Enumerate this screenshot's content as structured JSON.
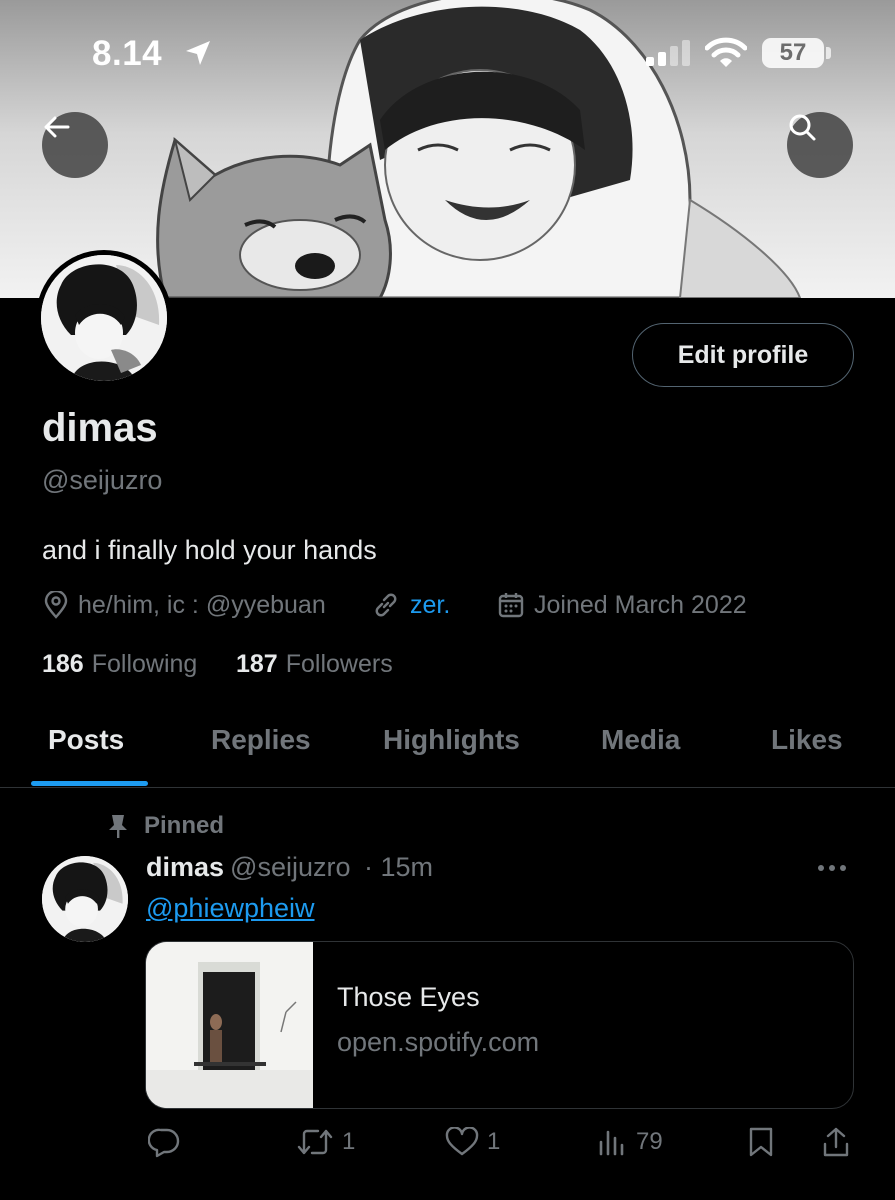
{
  "status_bar": {
    "time": "8.14",
    "battery": "57"
  },
  "profile": {
    "display_name": "dimas",
    "handle": "@seijuzro",
    "bio": "and i finally hold your hands",
    "location": "he/him, ic : @yyebuan",
    "website": "zer.",
    "joined": "Joined March 2022",
    "following_count": "186",
    "following_label": "Following",
    "followers_count": "187",
    "followers_label": "Followers",
    "edit_label": "Edit profile"
  },
  "tabs": [
    {
      "label": "Posts",
      "active": true
    },
    {
      "label": "Replies",
      "active": false
    },
    {
      "label": "Highlights",
      "active": false
    },
    {
      "label": "Media",
      "active": false
    },
    {
      "label": "Likes",
      "active": false
    }
  ],
  "post": {
    "pinned_label": "Pinned",
    "author_name": "dimas",
    "author_handle": "@seijuzro",
    "timestamp": "· 15m",
    "mention": "@phiewpheiw",
    "card": {
      "title": "Those Eyes",
      "domain": "open.spotify.com"
    },
    "actions": {
      "reply": "",
      "repost": "1",
      "like": "1",
      "views": "79"
    }
  },
  "icons": {
    "status": [
      "location-arrow-icon",
      "signal-icon",
      "wifi-icon"
    ],
    "nav": [
      "back-arrow-icon",
      "search-icon"
    ],
    "meta": [
      "location-pin-icon",
      "link-icon",
      "calendar-icon"
    ],
    "post": [
      "pin-icon",
      "more-icon",
      "reply-icon",
      "repost-icon",
      "like-icon",
      "views-icon",
      "bookmark-icon",
      "share-icon"
    ]
  },
  "colors": {
    "accent": "#1d9bf0",
    "background": "#000000",
    "text": "#e7e9ea",
    "muted": "#71767b",
    "border": "#2f3336"
  }
}
